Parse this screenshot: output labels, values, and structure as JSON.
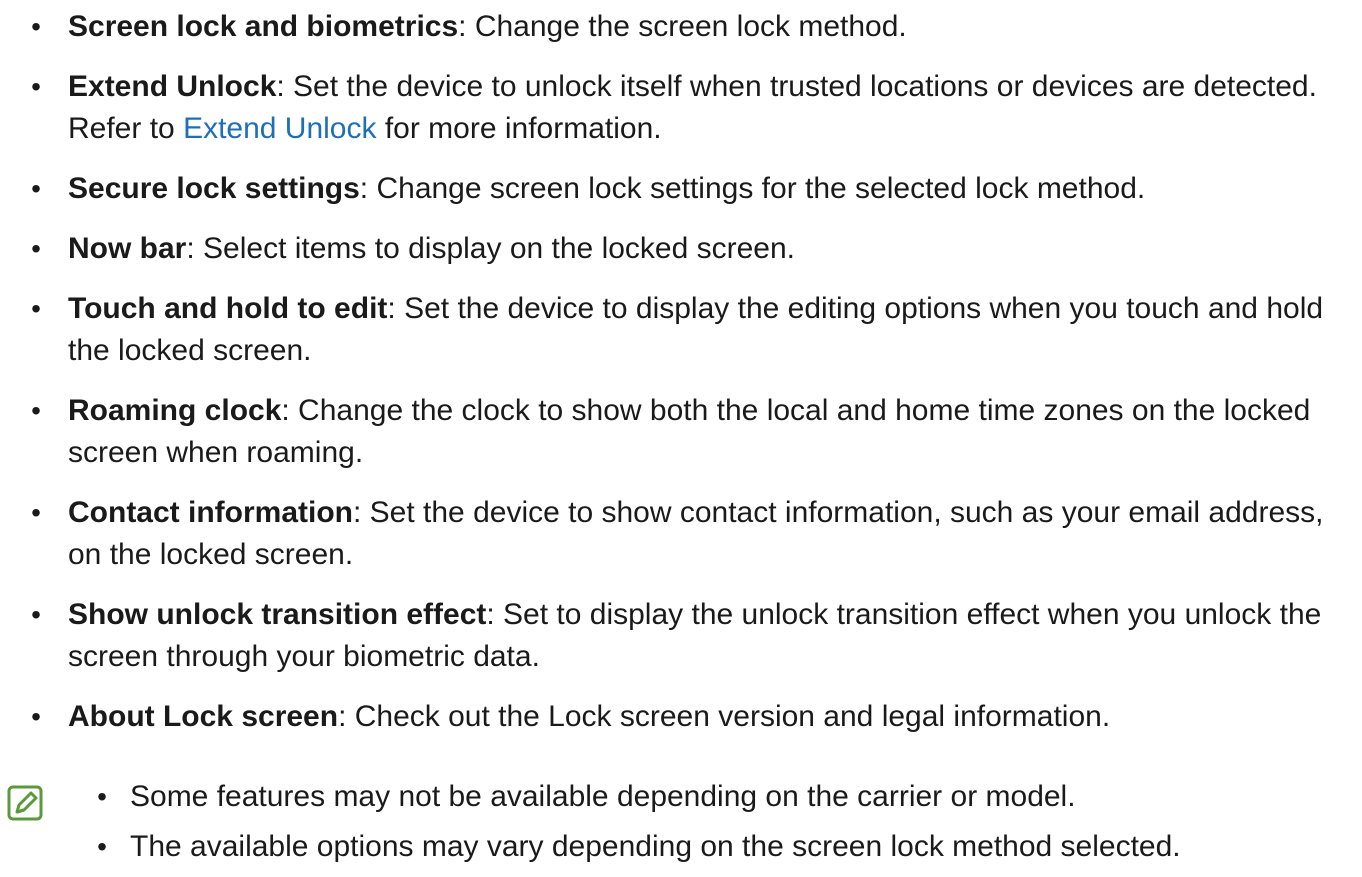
{
  "bullets": [
    {
      "term": "Screen lock and biometrics",
      "desc": ": Change the screen lock method."
    },
    {
      "term": "Extend Unlock",
      "desc": ": Set the device to unlock itself when trusted locations or devices are detected. Refer to ",
      "link": "Extend Unlock",
      "after": " for more information."
    },
    {
      "term": "Secure lock settings",
      "desc": ": Change screen lock settings for the selected lock method."
    },
    {
      "term": "Now bar",
      "desc": ": Select items to display on the locked screen."
    },
    {
      "term": "Touch and hold to edit",
      "desc": ": Set the device to display the editing options when you touch and hold the locked screen."
    },
    {
      "term": "Roaming clock",
      "desc": ": Change the clock to show both the local and home time zones on the locked screen when roaming."
    },
    {
      "term": "Contact information",
      "desc": ": Set the device to show contact information, such as your email address, on the locked screen."
    },
    {
      "term": "Show unlock transition effect",
      "desc": ": Set to display the unlock transition effect when you unlock the screen through your biometric data."
    },
    {
      "term": "About Lock screen",
      "desc": ": Check out the Lock screen version and legal information."
    }
  ],
  "notes": [
    "Some features may not be available depending on the carrier or model.",
    "The available options may vary depending on the screen lock method selected."
  ],
  "bullet_glyph": "•",
  "colors": {
    "text": "#1a1a1a",
    "link": "#1e6fb8",
    "note_icon": "#5a9a3a"
  },
  "icons": {
    "note": "note-pencil-icon"
  }
}
